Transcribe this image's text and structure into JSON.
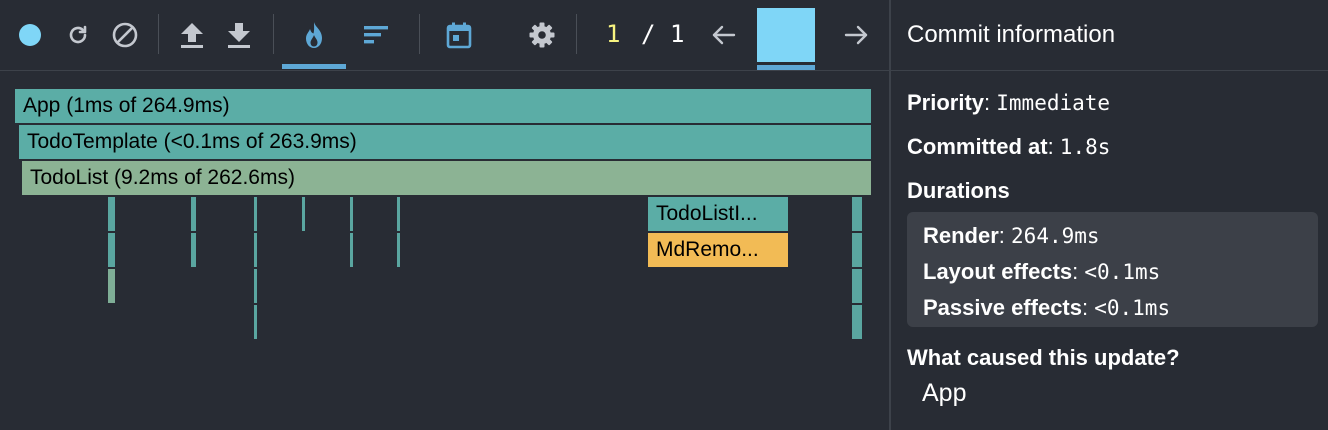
{
  "toolbar": {
    "buttons": [
      {
        "name": "record-button",
        "icon": "record-dot-icon"
      },
      {
        "name": "reload-and-profile-button",
        "icon": "reload-icon"
      },
      {
        "name": "clear-profile-button",
        "icon": "clear-icon"
      },
      {
        "name": "load-profile-button",
        "icon": "upload-icon"
      },
      {
        "name": "save-profile-button",
        "icon": "download-icon"
      },
      {
        "name": "flamegraph-tab",
        "icon": "flame-icon"
      },
      {
        "name": "ranked-tab",
        "icon": "ranked-bars-icon"
      },
      {
        "name": "timeline-tab",
        "icon": "calendar-icon"
      },
      {
        "name": "settings-button",
        "icon": "gear-icon"
      }
    ],
    "commit_index": "1",
    "commit_separator": "/",
    "commit_total": "1",
    "prev_icon": "arrow-left-icon",
    "next_icon": "arrow-right-icon"
  },
  "flamegraph": {
    "rows": [
      {
        "label": "App (1ms of 264.9ms)"
      },
      {
        "label": "TodoTemplate (<0.1ms of 263.9ms)"
      },
      {
        "label": "TodoList (9.2ms of 262.6ms)"
      }
    ],
    "todo_list_item": "TodoListI...",
    "md_remove": "MdRemo..."
  },
  "sidebar": {
    "title": "Commit information",
    "priority_label": "Priority",
    "priority_value": "Immediate",
    "committed_label": "Committed at",
    "committed_value": "1.8s",
    "durations_title": "Durations",
    "render_label": "Render",
    "render_value": "264.9ms",
    "layout_label": "Layout effects",
    "layout_value": "<0.1ms",
    "passive_label": "Passive effects",
    "passive_value": "<0.1ms",
    "cause_title": "What caused this update?",
    "cause_item": "App"
  },
  "colors": {
    "background": "#282c34",
    "accent": "#5ea8d6",
    "commit_bar": "#7fd6f7",
    "counter_highlight": "#f8f481",
    "flame_teal": "#5bada6",
    "flame_sage": "#8cb394",
    "flame_yellow": "#f2bb55"
  }
}
